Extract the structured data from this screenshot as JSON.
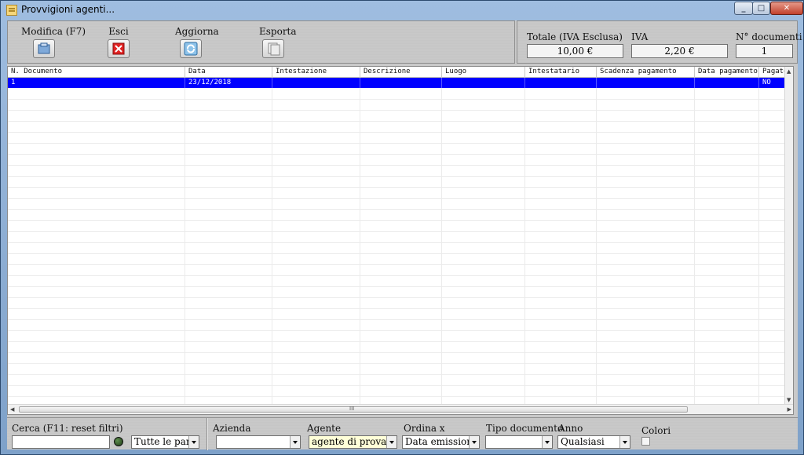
{
  "window": {
    "title": "Provvigioni agenti..."
  },
  "toolbar": {
    "modify_label": "Modifica (F7)",
    "exit_label": "Esci",
    "refresh_label": "Aggiorna",
    "export_label": "Esporta"
  },
  "totals": {
    "total_label": "Totale (IVA Esclusa)",
    "total_value": "10,00 €",
    "iva_label": "IVA",
    "iva_value": "2,20 €",
    "docs_label": "N° documenti",
    "docs_value": "1"
  },
  "grid": {
    "columns": [
      "N. Documento",
      "Data",
      "Intestazione",
      "Descrizione",
      "Luogo",
      "Intestatario",
      "Scadenza pagamento",
      "Data pagamento",
      "Pagato"
    ],
    "rows": [
      [
        "1",
        "23/12/2018",
        "",
        "",
        "",
        "",
        "",
        "",
        "NO"
      ]
    ],
    "scroll_grip": "III"
  },
  "filters": {
    "search_label": "Cerca (F11: reset filtri)",
    "search_value": "",
    "words_mode": "Tutte le parole",
    "company_label": "Azienda",
    "company_value": "",
    "agent_label": "Agente",
    "agent_value": "agente di prova",
    "order_label": "Ordina x",
    "order_value": "Data emissione",
    "doctype_label": "Tipo documento",
    "doctype_value": "",
    "year_label": "Anno",
    "year_value": "Qualsiasi",
    "colors_label": "Colori"
  },
  "colors": {
    "selection": "#0000ff",
    "agent_field_bg": "#ffffd8"
  }
}
